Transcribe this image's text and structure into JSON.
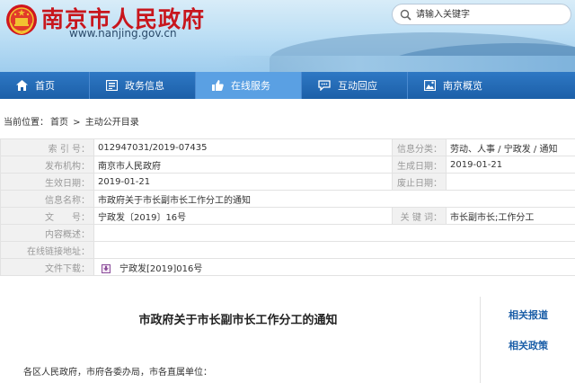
{
  "header": {
    "site_title": "南京市人民政府",
    "site_url": "www.nanjing.gov.cn",
    "search_placeholder": "请输入关键字"
  },
  "nav": {
    "items": [
      {
        "label": "首页",
        "icon": "home-icon"
      },
      {
        "label": "政务信息",
        "icon": "info-icon"
      },
      {
        "label": "在线服务",
        "icon": "thumbs-up-icon",
        "active": true
      },
      {
        "label": "互动回应",
        "icon": "chat-icon"
      },
      {
        "label": "南京概览",
        "icon": "overview-icon"
      }
    ]
  },
  "breadcrumb": {
    "prefix": "当前位置：",
    "home": "首页",
    "sep": " > ",
    "current": "主动公开目录"
  },
  "meta": {
    "index_label": "索 引 号：",
    "index_value": "012947031/2019-07435",
    "category_label": "信息分类：",
    "category_value": "劳动、人事 / 宁政发 / 通知",
    "issuer_label": "发布机构：",
    "issuer_value": "南京市人民政府",
    "created_label": "生成日期：",
    "created_value": "2019-01-21",
    "effective_label": "生效日期：",
    "effective_value": "2019-01-21",
    "repeal_label": "废止日期：",
    "repeal_value": "",
    "name_label": "信息名称：",
    "name_value": "市政府关于市长副市长工作分工的通知",
    "docno_label": "文　　号：",
    "docno_value": "宁政发〔2019〕16号",
    "keywords_label": "关 键 词：",
    "keywords_value": "市长副市长;工作分工",
    "summary_label": "内容概述：",
    "summary_value": "",
    "link_label": "在线链接地址：",
    "link_value": "",
    "download_label": "文件下载：",
    "download_value": "宁政发[2019]016号"
  },
  "article": {
    "title": "市政府关于市长副市长工作分工的通知",
    "greeting": "各区人民政府，市府各委办局，市各直属单位："
  },
  "sidebar": {
    "related_reports": "相关报道",
    "related_policies": "相关政策"
  },
  "colors": {
    "brand_red": "#c8161d",
    "nav_blue": "#1c5fa8",
    "nav_active": "#5aa0e3"
  }
}
